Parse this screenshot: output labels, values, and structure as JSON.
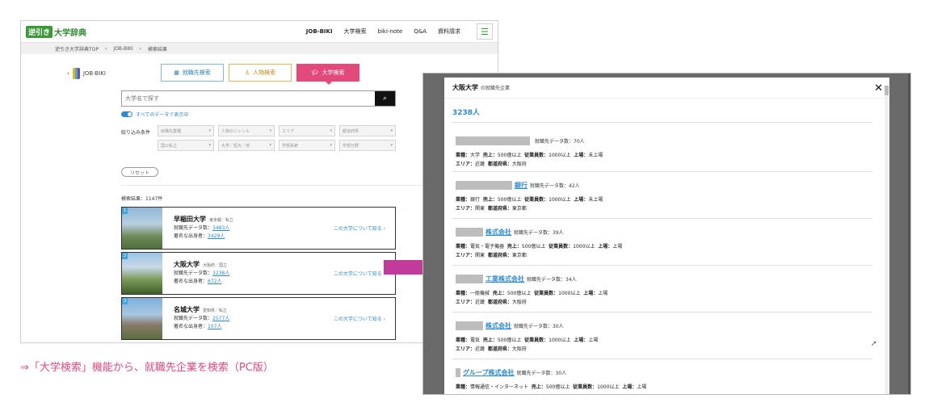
{
  "left": {
    "logo_badge": "逆引き",
    "logo_text": "大学辞典",
    "nav": [
      "JOB-BIKI",
      "大学検索",
      "biki-note",
      "Q&A",
      "資料請求"
    ],
    "menu_icon": "hamburger-icon",
    "breadcrumb": [
      "逆引き大学辞典TOP",
      "JOB-BIKI",
      "検索結果"
    ],
    "jobbiki_logo": "JOB-BIKI",
    "tabs": [
      "就職先検索",
      "人物検索",
      "大学検索"
    ],
    "search_placeholder": "大学名で探す",
    "toggle_label": "すべてのデータで表示中",
    "filter_label": "絞り込み条件",
    "filters": [
      "就職先業種",
      "人物のジャンル",
      "エリア",
      "都道府県",
      "国公私立",
      "大学／短大／他",
      "学部系統",
      "学部分野"
    ],
    "reset_label": "リセット",
    "results_count": "検索結果：1147件",
    "results": [
      {
        "num": "1",
        "name": "早稲田大学",
        "loc": "東京都／私立",
        "job_label": "就職先データ数：",
        "job_val": "3483人",
        "fam_label": "著名な出身者：",
        "fam_val": "3429人",
        "more": "この大学について知る ›"
      },
      {
        "num": "2",
        "name": "大阪大学",
        "loc": "大阪府／国立",
        "job_label": "就職先データ数：",
        "job_val": "3238人",
        "fam_label": "著名な出身者：",
        "fam_val": "672人",
        "more": "この大学について知る ›"
      },
      {
        "num": "3",
        "name": "名城大学",
        "loc": "愛知県／私立",
        "job_label": "就職先データ数：",
        "job_val": "2577人",
        "fam_label": "著名な出身者：",
        "fam_val": "107人",
        "more": "この大学について知る ›"
      }
    ]
  },
  "caption": "⇒「大学検索」機能から、就職先企業を検索（PC版）",
  "modal": {
    "univ": "大阪大学",
    "subtitle": "の就職先企業",
    "count": "3238人",
    "close": "✕",
    "labels": {
      "gyoshu": "業種：",
      "uriage": "売上：",
      "jugyoin": "従業員数：",
      "jojo": "上場：",
      "area": "エリア：",
      "pref": "都道府県："
    },
    "companies": [
      {
        "name": "",
        "data": "就職先データ数：70人",
        "gyoshu": "大学",
        "uriage": "500億以上",
        "jugyoin": "1000以上",
        "jojo": "未上場",
        "area": "近畿",
        "pref": "大阪府"
      },
      {
        "name": "銀行",
        "data": "就職先データ数：42人",
        "gyoshu": "銀行",
        "uriage": "500億以上",
        "jugyoin": "1000以上",
        "jojo": "未上場",
        "area": "関東",
        "pref": "東京都"
      },
      {
        "name": "株式会社",
        "data": "就職先データ数：39人",
        "gyoshu": "電気・電子機器",
        "uriage": "500億以上",
        "jugyoin": "1000以上",
        "jojo": "上場",
        "area": "関東",
        "pref": "東京都"
      },
      {
        "name": "工業株式会社",
        "data": "就職先データ数：34人",
        "gyoshu": "一般機械",
        "uriage": "500億以上",
        "jugyoin": "1000以上",
        "jojo": "上場",
        "area": "近畿",
        "pref": "大阪府"
      },
      {
        "name": "株式会社",
        "data": "就職先データ数：30人",
        "gyoshu": "電気",
        "uriage": "500億以上",
        "jugyoin": "1000以上",
        "jojo": "上場",
        "area": "近畿",
        "pref": "大阪府"
      },
      {
        "name": "グループ株式会社",
        "data": "就職先データ数：30人",
        "gyoshu": "情報通信・インターネット",
        "uriage": "500億以上",
        "jugyoin": "1000以上",
        "jojo": "上場",
        "area": "",
        "pref": ""
      }
    ]
  },
  "colors": {
    "brand_green": "#3a9a3a",
    "accent_pink": "#e4497c",
    "link_blue": "#2c8ad4"
  }
}
